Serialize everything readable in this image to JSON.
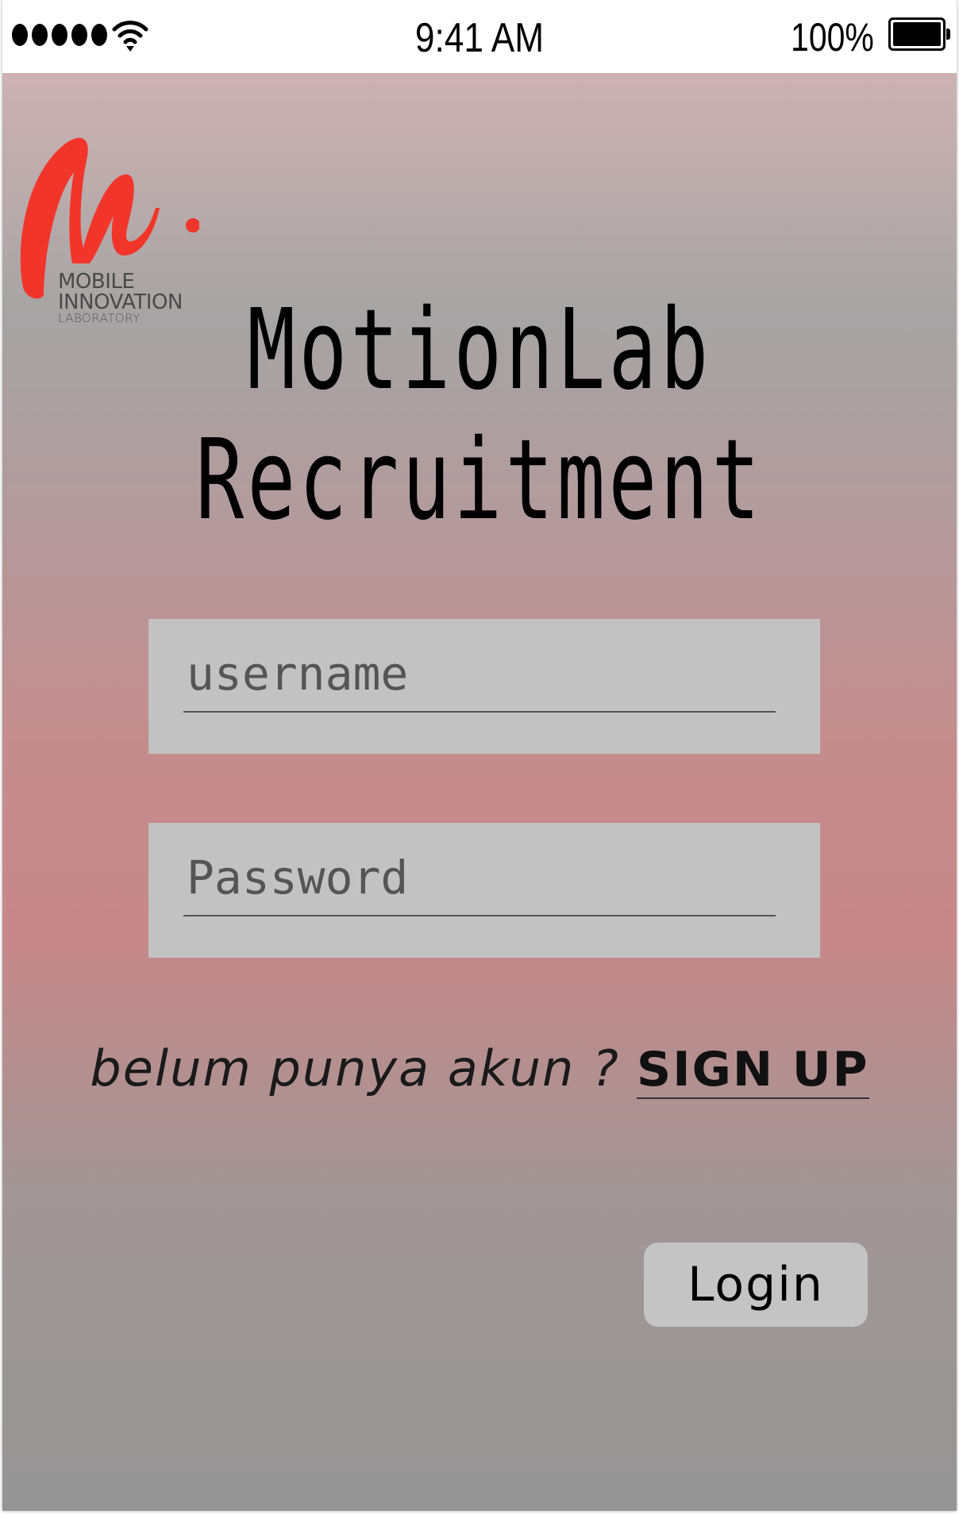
{
  "status_bar": {
    "time": "9:41 AM",
    "battery_percent": "100%",
    "signal_bars": 5,
    "icons": [
      "signal-dots-icon",
      "wifi-icon",
      "battery-icon"
    ]
  },
  "logo": {
    "line1": "MOBILE",
    "line2": "INNOVATION",
    "line3": "LABORATORY",
    "mark_color": "#f2352a"
  },
  "title": {
    "line1": "MotionLab",
    "line2": "Recruitment"
  },
  "form": {
    "username_placeholder": "username",
    "username_value": "",
    "password_placeholder": "Password",
    "password_value": ""
  },
  "signup": {
    "prompt": "belum punya akun ?",
    "link_label": "SIGN UP"
  },
  "login": {
    "label": "Login"
  }
}
